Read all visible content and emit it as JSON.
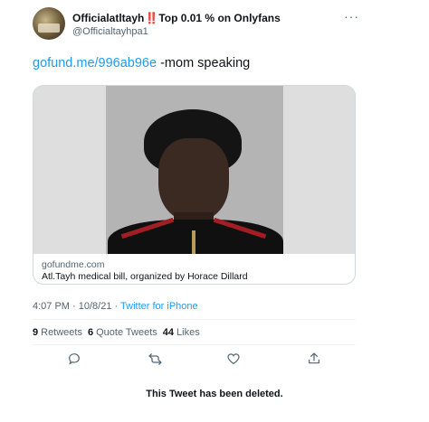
{
  "header": {
    "display_name": "Officialatltayh",
    "name_badge": "‼️",
    "name_suffix": "Top 0.01 % on Onlyfans",
    "handle": "@Officialtayhpa1",
    "more_icon": "more-horizontal-icon"
  },
  "tweet": {
    "link_text": "gofund.me/996ab96e",
    "body_text": " -mom speaking"
  },
  "card": {
    "domain": "gofundme.com",
    "title": "Atl.Tayh medical bill, organized by Horace Dillard"
  },
  "meta": {
    "time": "4:07 PM",
    "separator": " · ",
    "date": "10/8/21",
    "source": "Twitter for iPhone"
  },
  "stats": {
    "retweets_count": "9",
    "retweets_label": "Retweets",
    "quotes_count": "6",
    "quotes_label": "Quote Tweets",
    "likes_count": "44",
    "likes_label": "Likes"
  },
  "actions": [
    {
      "icon": "reply-icon"
    },
    {
      "icon": "retweet-icon"
    },
    {
      "icon": "like-icon"
    },
    {
      "icon": "share-icon"
    }
  ],
  "notice": {
    "deleted": "This Tweet has been deleted."
  },
  "colors": {
    "link": "#1d9bf0",
    "secondary_text": "#536471",
    "badge": "#e0245e"
  }
}
